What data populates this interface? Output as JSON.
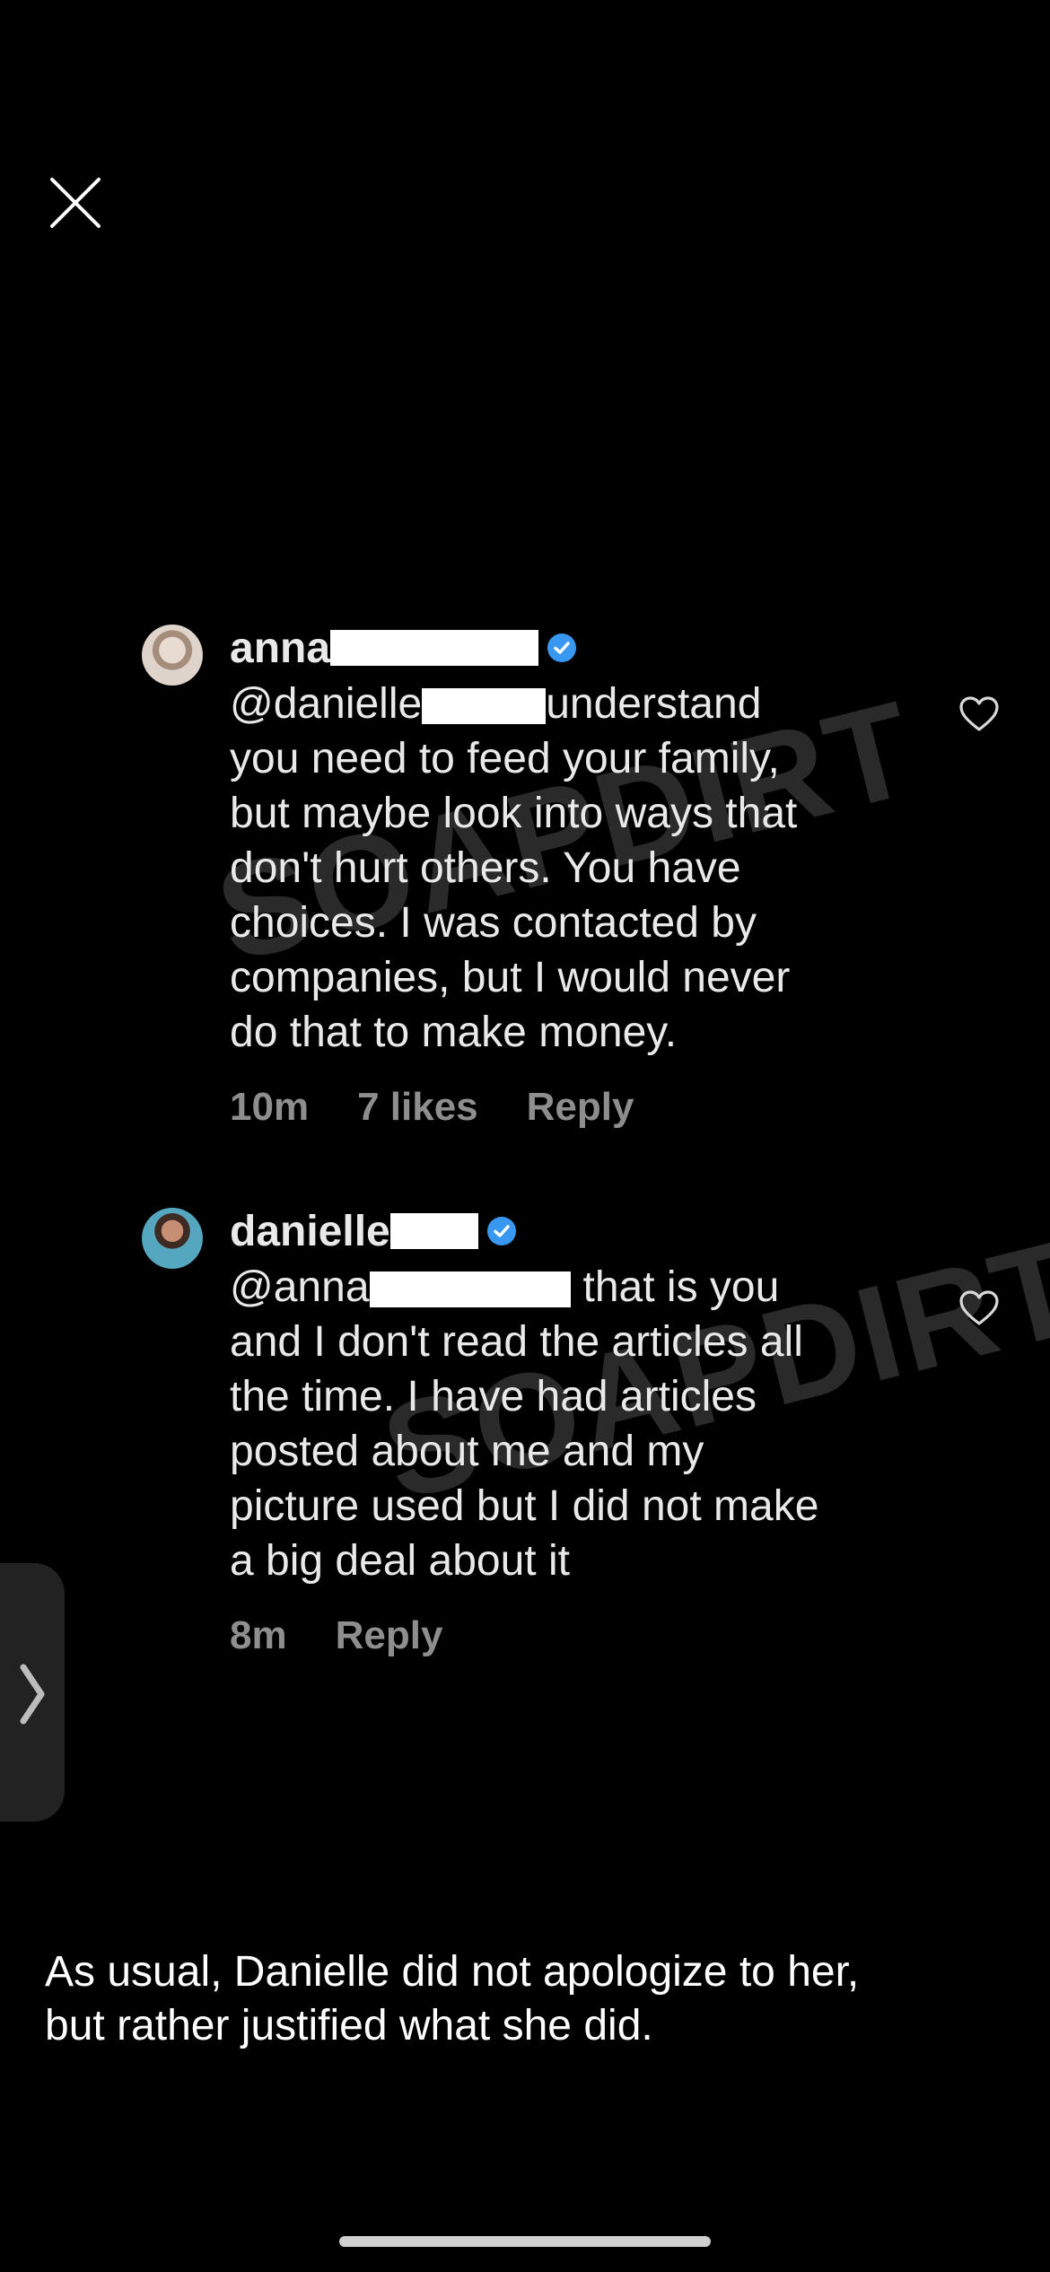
{
  "viewer": {
    "close_icon": "close-icon",
    "side_tab_icon": "chevron-right-icon"
  },
  "watermark": {
    "text1": "SOAPDIRT",
    "text2": "SOAPDIRT"
  },
  "comments": [
    {
      "username": "anna",
      "verified": true,
      "mention": "@danielle",
      "text_after_mention": "understand",
      "lines": [
        "you need to feed your family,",
        "but maybe look into ways that",
        "don't hurt others. You have",
        "choices. I was contacted by",
        "companies, but I would never",
        "do that to make money."
      ],
      "time": "10m",
      "likes": "7 likes",
      "reply_label": "Reply"
    },
    {
      "username": "danielle",
      "verified": true,
      "mention": "@anna",
      "text_after_mention": "that is you",
      "lines": [
        "and I don't read the articles all",
        "the time. I have had articles",
        "posted about me and my",
        "picture used but I did not make",
        "a big deal about it"
      ],
      "time": "8m",
      "reply_label": "Reply"
    }
  ],
  "caption": {
    "line1": "As usual, Danielle did not apologize to her,",
    "line2": "but rather justified what she did."
  },
  "colors": {
    "background": "#000000",
    "verified_blue": "#3897f0",
    "meta_gray": "#8e8e8e"
  }
}
